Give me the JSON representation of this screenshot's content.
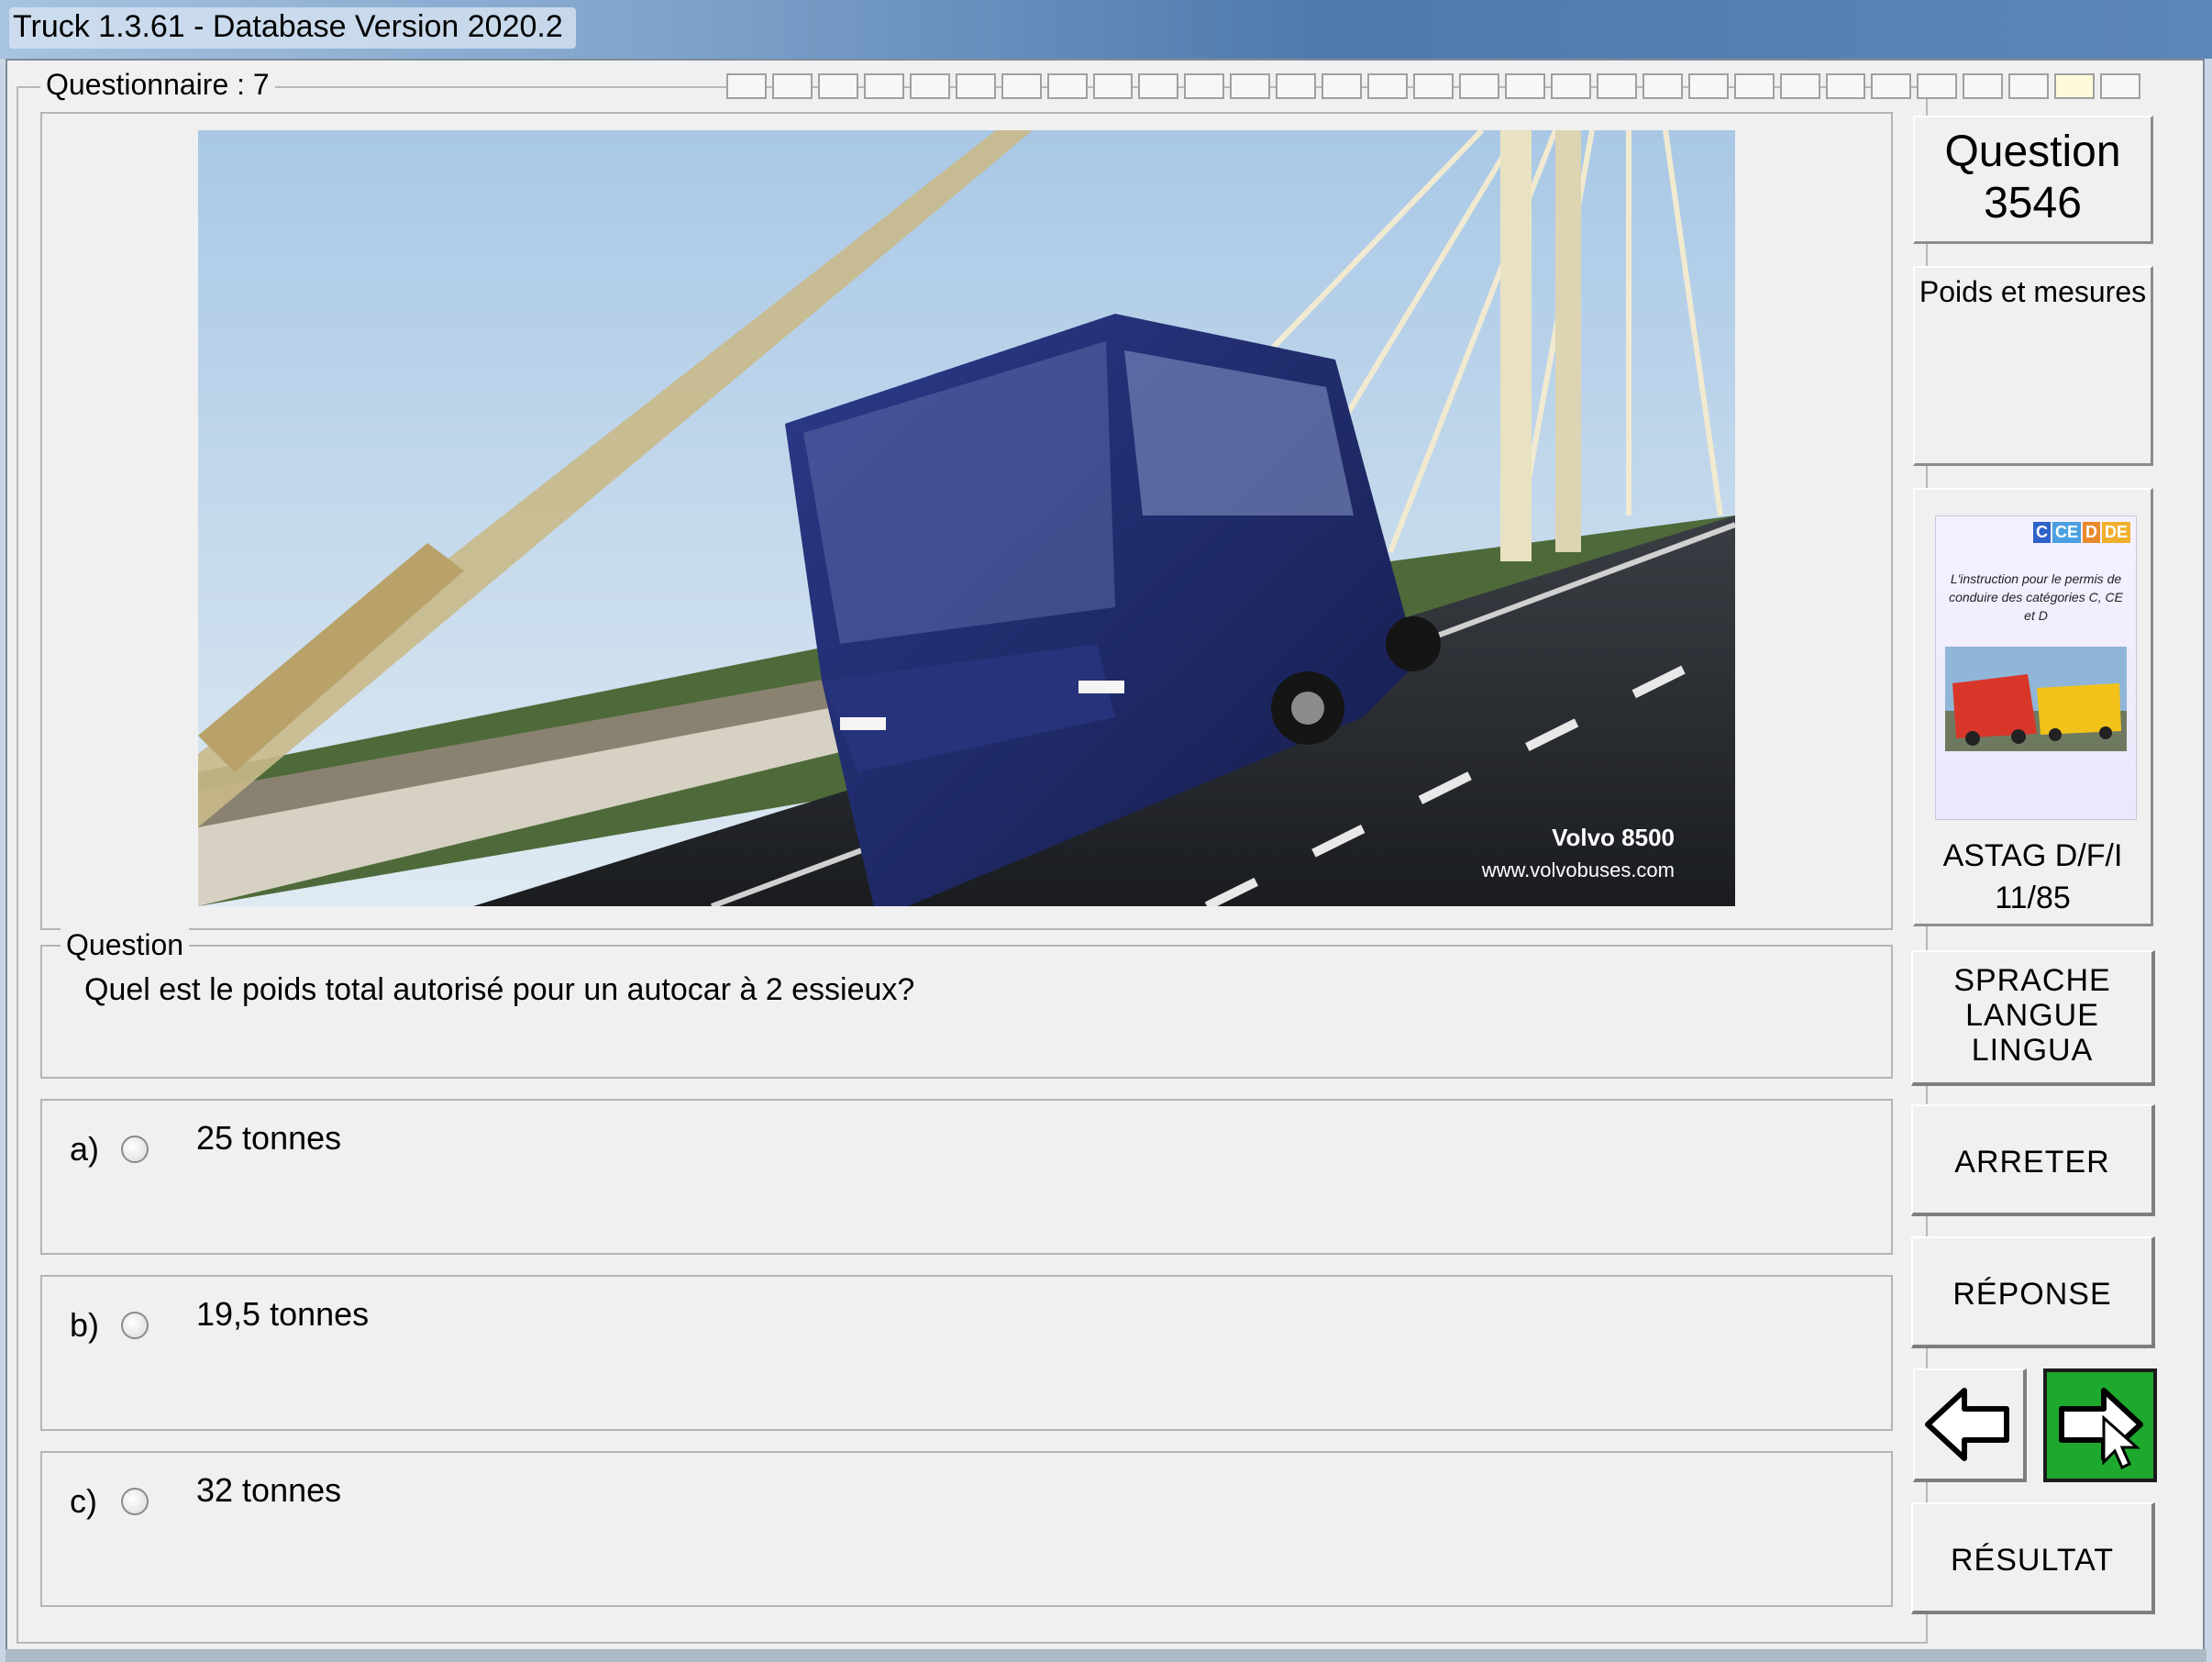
{
  "window": {
    "title": "Truck 1.3.61 - Database Version 2020.2"
  },
  "questionnaire": {
    "label": "Questionnaire : 7",
    "segments": 31,
    "current_segment": 29
  },
  "photo": {
    "caption_model": "Volvo 8500",
    "caption_url": "www.volvobuses.com"
  },
  "question": {
    "group_label": "Question",
    "text": "Quel est le poids total autorisé pour un autocar à 2 essieux?"
  },
  "answers": [
    {
      "letter": "a)",
      "text": "25 tonnes"
    },
    {
      "letter": "b)",
      "text": "19,5 tonnes"
    },
    {
      "letter": "c)",
      "text": "32 tonnes"
    }
  ],
  "sidebar": {
    "question_label": "Question",
    "question_number": "3546",
    "category": "Poids et mesures",
    "book": {
      "tags": [
        "C",
        "CE",
        "D",
        "DE"
      ],
      "title_text": "L'instruction pour le permis de conduire des catégories C, CE et D",
      "caption_line1": "ASTAG D/F/I",
      "caption_line2": "11/85"
    },
    "buttons": {
      "language_line1": "SPRACHE",
      "language_line2": "LANGUE",
      "language_line3": "LINGUA",
      "stop": "ARRETER",
      "response": "RÉPONSE",
      "result": "RÉSULTAT"
    }
  },
  "colors": {
    "next_button": "#1ea82e",
    "bus": "#1f2a6e",
    "sky": "#b8d3ea"
  }
}
